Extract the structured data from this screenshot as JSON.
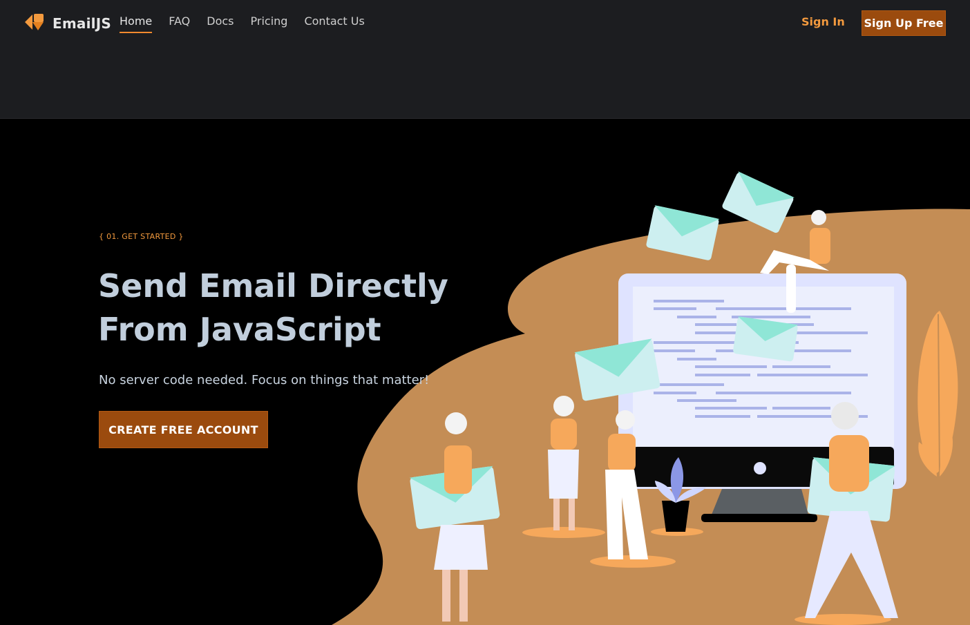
{
  "header": {
    "brand": "EmailJS",
    "nav": [
      {
        "label": "Home",
        "active": true
      },
      {
        "label": "FAQ"
      },
      {
        "label": "Docs"
      },
      {
        "label": "Pricing"
      },
      {
        "label": "Contact Us"
      }
    ],
    "signin_label": "Sign In",
    "signup_label": "Sign Up Free"
  },
  "hero": {
    "eyebrow": "{ 01. GET STARTED }",
    "title_line1": "Send Email Directly",
    "title_line2": "From JavaScript",
    "subtitle": "No server code needed. Focus on things that matter!",
    "cta_label": "CREATE FREE ACCOUNT"
  },
  "colors": {
    "accent": "#f39a3e",
    "button": "#9b4b0e",
    "blob": "#c48d55",
    "envelope": "#8fe6d6",
    "header_bg": "#1c1d20"
  }
}
